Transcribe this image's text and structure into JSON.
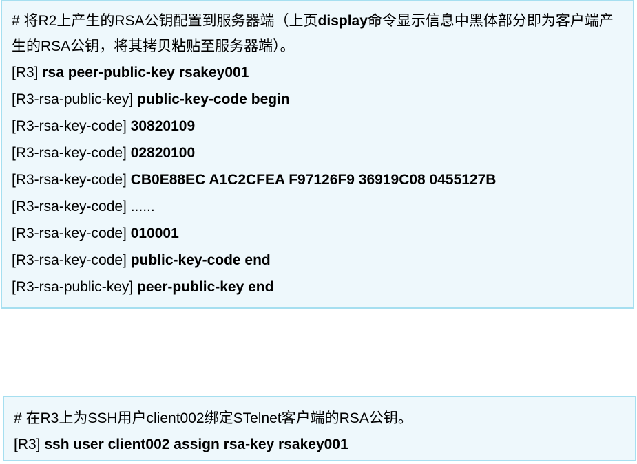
{
  "block1": {
    "intro": {
      "part1": "# 将R2上产生的RSA公钥配置到服务器端（上页",
      "bold": "display",
      "part2": "命令显示信息中黑体部分即为客户端产生的RSA公钥，将其拷贝粘贴至服务器端）。"
    },
    "lines": [
      {
        "prompt": "[R3] ",
        "cmd": "rsa peer-public-key rsakey001"
      },
      {
        "prompt": "[R3-rsa-public-key] ",
        "cmd": "public-key-code begin"
      },
      {
        "prompt": "[R3-rsa-key-code] ",
        "cmd": "30820109"
      },
      {
        "prompt": "[R3-rsa-key-code] ",
        "cmd": "02820100"
      },
      {
        "prompt": "[R3-rsa-key-code] ",
        "cmd": "CB0E88EC A1C2CFEA F97126F9 36919C08 0455127B"
      },
      {
        "prompt": "[R3-rsa-key-code] ",
        "cmd": "......"
      },
      {
        "prompt": "[R3-rsa-key-code] ",
        "cmd": "010001"
      },
      {
        "prompt": "[R3-rsa-key-code] ",
        "cmd": "public-key-code end"
      },
      {
        "prompt": "[R3-rsa-public-key] ",
        "cmd": "peer-public-key end"
      }
    ]
  },
  "block2": {
    "intro": "# 在R3上为SSH用户client002绑定STelnet客户端的RSA公钥。",
    "lines": [
      {
        "prompt": "[R3] ",
        "cmd": "ssh user client002 assign rsa-key rsakey001"
      }
    ]
  },
  "colors": {
    "box_background": "#eef8fc",
    "box_border": "#a6dff0",
    "text": "#000000"
  }
}
